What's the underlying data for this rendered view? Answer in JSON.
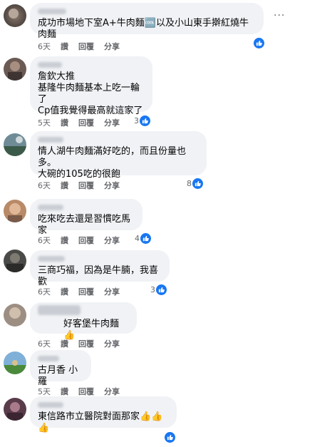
{
  "comments": [
    {
      "text": "成功市場地下室A+牛肉麵🆒以及小山東手擀紅燒牛肉麵",
      "time": "6天",
      "reactions": ""
    },
    {
      "text": "詹欽大推\n基隆牛肉麵基本上吃一輪了\nCp值我覺得最高就這家了",
      "time": "5天",
      "reactions": "3"
    },
    {
      "text": "情人湖牛肉麵滿好吃的，而且份量也多。\n大碗的105吃的很飽",
      "time": "6天",
      "reactions": "8"
    },
    {
      "text": "吃來吃去還是習慣吃馬家",
      "time": "6天",
      "reactions": "4"
    },
    {
      "text": "三商巧福，因為是牛腩，我喜歡",
      "time": "6天",
      "reactions": "3"
    },
    {
      "text": "好客堡牛肉麵👍",
      "time": "6天",
      "reactions": ""
    },
    {
      "text": "古月香 小羅",
      "time": "5天",
      "reactions": ""
    },
    {
      "text": "東信路市立醫院對面那家👍👍👍",
      "time": "6天",
      "reactions": ""
    }
  ],
  "labels": {
    "read": "讚",
    "reply": "回覆",
    "share": "分享",
    "more": "···"
  }
}
